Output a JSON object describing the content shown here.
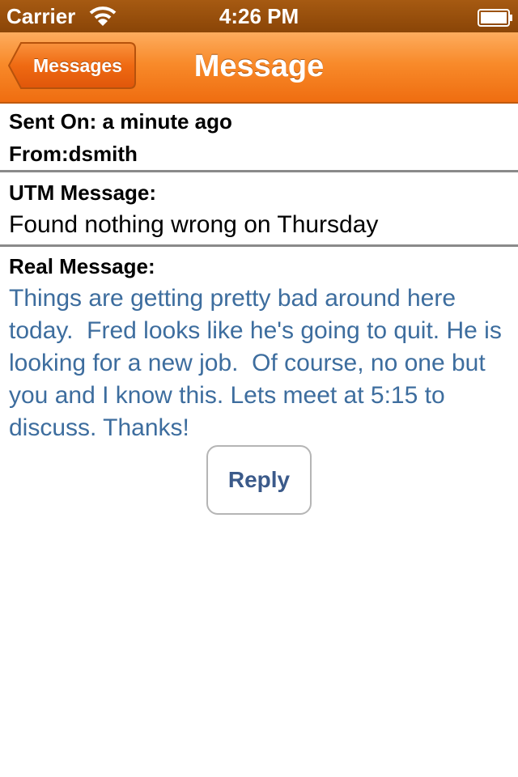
{
  "status_bar": {
    "carrier": "Carrier",
    "time": "4:26 PM",
    "wifi_icon": "wifi-icon",
    "battery_icon": "battery-icon"
  },
  "nav_bar": {
    "back_label": "Messages",
    "title": "Message",
    "accent_color": "#f57d1f"
  },
  "header": {
    "sent_on": "Sent On: a minute ago",
    "from": "From:dsmith"
  },
  "utm_section": {
    "label": "UTM Message:",
    "text": "Found nothing wrong on Thursday"
  },
  "real_section": {
    "label": "Real Message:",
    "text": "Things are getting pretty bad around here today.  Fred looks like he's going to quit. He is looking for a new job.  Of course, no one but you and I know this. Lets meet at 5:15 to discuss. Thanks!",
    "text_color": "#3d6d9e"
  },
  "actions": {
    "reply_label": "Reply"
  }
}
